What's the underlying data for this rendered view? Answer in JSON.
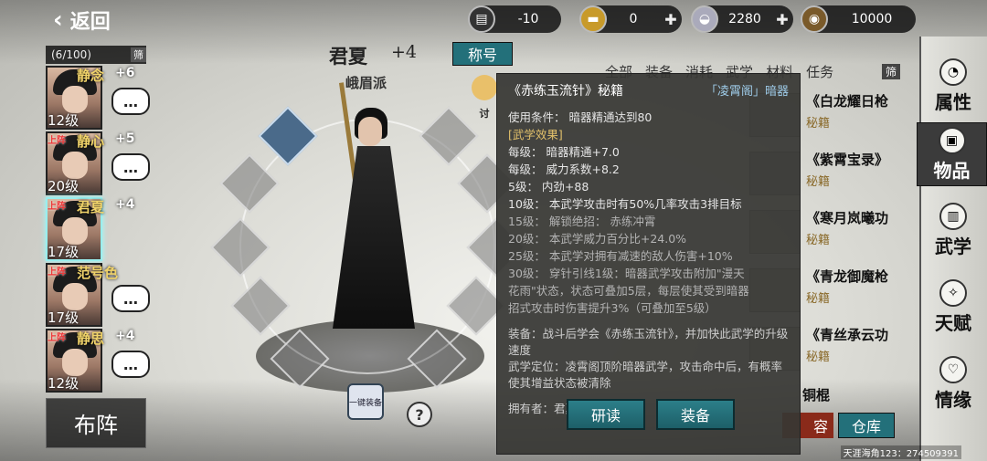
{
  "header": {
    "back_label": "返回",
    "resources": [
      {
        "icon": "cart-icon",
        "value": "-10",
        "has_plus": false
      },
      {
        "icon": "gold-bar-icon",
        "value": "0",
        "has_plus": true
      },
      {
        "icon": "silver-ingot-icon",
        "value": "2280",
        "has_plus": true
      },
      {
        "icon": "coin-icon",
        "value": "10000",
        "has_plus": false
      }
    ]
  },
  "roster": {
    "count": "(6/100)",
    "filter_label": "筛",
    "members": [
      {
        "name": "静念",
        "plus": "+6",
        "level": "12级",
        "tag": "",
        "selected": false
      },
      {
        "name": "静心",
        "plus": "+5",
        "level": "20级",
        "tag": "上阵",
        "selected": false
      },
      {
        "name": "君夏",
        "plus": "+4",
        "level": "17级",
        "tag": "上阵",
        "selected": true
      },
      {
        "name": "范号色",
        "plus": "",
        "level": "17级",
        "tag": "上阵",
        "selected": false
      },
      {
        "name": "静思",
        "plus": "+4",
        "level": "12级",
        "tag": "上阵",
        "selected": false
      }
    ],
    "chat_glyph": "…",
    "formation_label": "布阵"
  },
  "character": {
    "name": "君夏",
    "enhance": "+4",
    "sect": "峨眉派",
    "title_button": "称号",
    "pet_label": "讨",
    "helper_label": "一键装备",
    "help_glyph": "?"
  },
  "item_list": {
    "tabs": [
      "全部",
      "装备",
      "消耗",
      "武学",
      "材料",
      "任务"
    ],
    "sort_label": "筛",
    "items": [
      {
        "name": "《白龙耀日枪",
        "type": "秘籍"
      },
      {
        "name": "《紫霄宝录》",
        "type": "秘籍"
      },
      {
        "name": "《寒月岚曦功",
        "type": "秘籍"
      },
      {
        "name": "《青龙御魔枪",
        "type": "秘籍"
      },
      {
        "name": "《青丝承云功",
        "type": "秘籍"
      }
    ],
    "partial_item": "铜棍",
    "capacity_label": "容",
    "warehouse_label": "仓库"
  },
  "nav": [
    {
      "label": "属性",
      "icon": "cat-icon",
      "active": false
    },
    {
      "label": "物品",
      "icon": "bag-icon",
      "active": true
    },
    {
      "label": "武学",
      "icon": "book-icon",
      "active": false
    },
    {
      "label": "天赋",
      "icon": "talent-icon",
      "active": false
    },
    {
      "label": "情缘",
      "icon": "heart-icon",
      "active": false
    }
  ],
  "popup": {
    "title": "《赤练玉流针》秘籍",
    "sect": "「凌霄阁」暗器",
    "condition": "使用条件：  暗器精通达到80",
    "effect_header": "[武学效果]",
    "lines": [
      {
        "text": "每级：  暗器精通+7.0",
        "style": "normal"
      },
      {
        "text": "每级：  威力系数+8.2",
        "style": "normal"
      },
      {
        "text": "5级：   内劲+88",
        "style": "normal"
      },
      {
        "text": "10级：  本武学攻击时有50%几率攻击3排目标",
        "style": "normal"
      },
      {
        "text": "15级：  解锁绝招：  赤练冲霄",
        "style": "dim"
      },
      {
        "text": "20级：  本武学威力百分比+24.0%",
        "style": "dim"
      },
      {
        "text": "25级：  本武学对拥有减速的敌人伤害+10%",
        "style": "dim"
      },
      {
        "text": "30级：  穿针引线1级：暗器武学攻击附加\"漫天",
        "style": "dim"
      },
      {
        "text": "花雨\"状态，状态可叠加5层，每层使其受到暗器",
        "style": "dim"
      },
      {
        "text": "招式攻击时伤害提升3%（可叠加至5级）",
        "style": "dim"
      }
    ],
    "equip_text": "装备：战斗后学会《赤练玉流针》，并加快此武学的升级速度",
    "position_text": "武学定位：凌霄阁顶阶暗器武学，攻击命中后，有概率使其增益状态被清除",
    "owner": "拥有者：君夏",
    "read_button": "研读",
    "equip_button": "装备"
  },
  "watermark": "天涯海角123：274509391"
}
